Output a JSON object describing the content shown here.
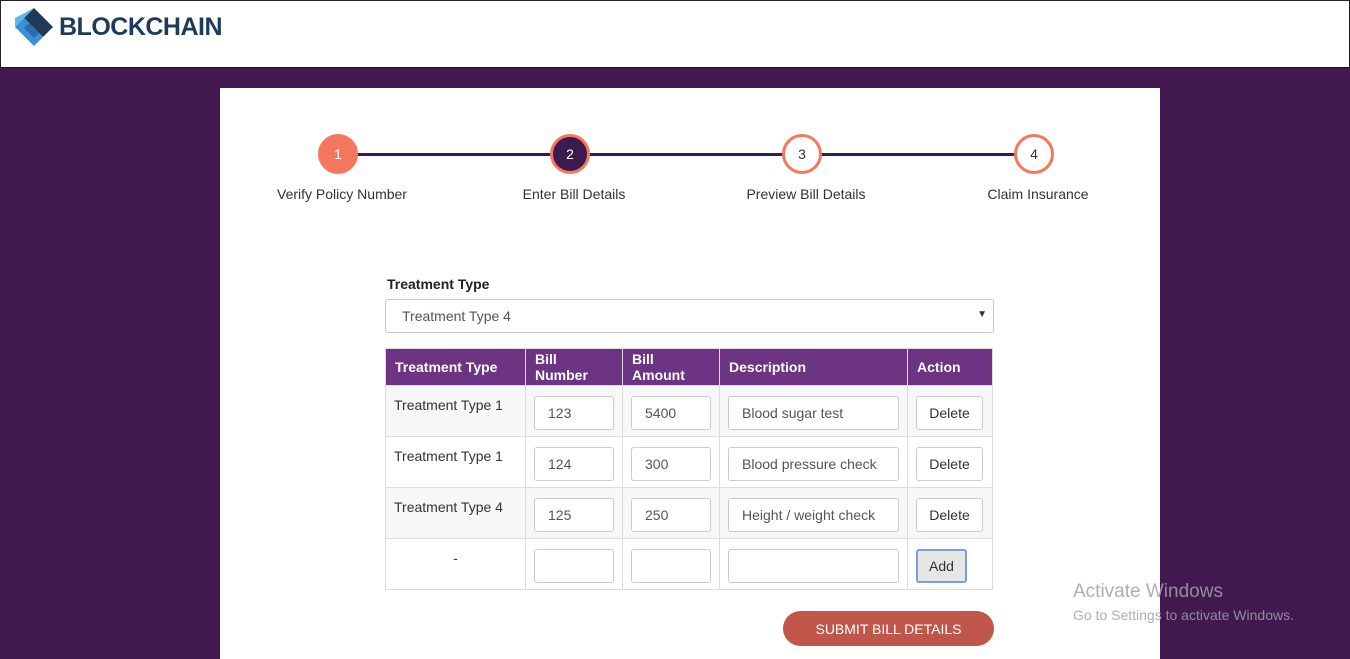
{
  "header": {
    "brand": "BLOCKCHAIN"
  },
  "steps": [
    {
      "number": "1",
      "label": "Verify Policy Number",
      "state": "done"
    },
    {
      "number": "2",
      "label": "Enter Bill Details",
      "state": "active"
    },
    {
      "number": "3",
      "label": "Preview Bill Details",
      "state": "todo"
    },
    {
      "number": "4",
      "label": "Claim Insurance",
      "state": "todo"
    }
  ],
  "form": {
    "treatment_label": "Treatment Type",
    "treatment_selected": "Treatment Type 4"
  },
  "table": {
    "headers": [
      "Treatment Type",
      "Bill Number",
      "Bill Amount",
      "Description",
      "Action"
    ],
    "rows": [
      {
        "type": "Treatment Type 1",
        "bill_number": "123",
        "bill_amount": "5400",
        "description": "Blood sugar test",
        "action": "Delete"
      },
      {
        "type": "Treatment Type 1",
        "bill_number": "124",
        "bill_amount": "300",
        "description": "Blood pressure check",
        "action": "Delete"
      },
      {
        "type": "Treatment Type 4",
        "bill_number": "125",
        "bill_amount": "250",
        "description": "Height / weight check",
        "action": "Delete"
      }
    ],
    "new_row": {
      "type": "-",
      "action": "Add"
    }
  },
  "submit_label": "SUBMIT BILL DETAILS",
  "watermark": {
    "line1": "Activate Windows",
    "line2": "Go to Settings to activate Windows."
  },
  "colors": {
    "page_bg": "#41194f",
    "header_row": "#6c3483",
    "accent": "#f5785e",
    "step_active": "#3b1a4f",
    "submit": "#c0564a"
  }
}
